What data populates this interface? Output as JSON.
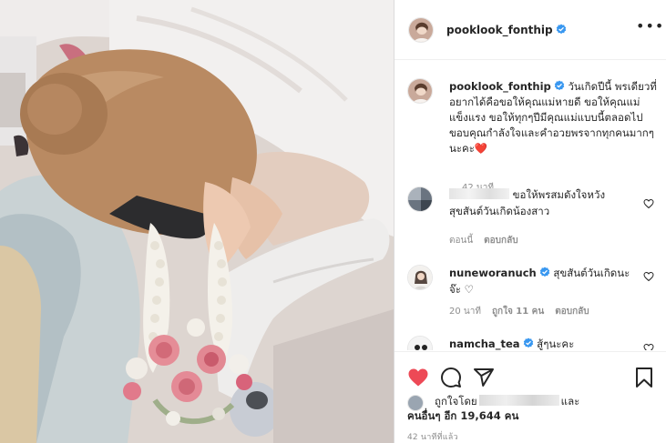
{
  "post": {
    "username": "pooklook_fonthip",
    "more_label": "•••",
    "image_alt": "Woman with garland bowing at hospital bed",
    "caption": {
      "username": "pooklook_fonthip",
      "text": "วันเกิดปีนี้ พรเดียวที่อยากได้คือขอให้คุณแม่หายดี ขอให้คุณแม่แข็งแรง ขอให้ทุกๆปีมีคุณแม่แบบนี้ตลอดไป ขอบคุณกำลังใจและคำอวยพรจากทุกคนมากๆนะคะ",
      "emoji": "❤️",
      "time": "42 นาที"
    },
    "comments": [
      {
        "username": "",
        "text": "ขอให้พรสมดังใจหวัง สุขสันต์วันเกิดน้องสาว",
        "meta": [
          "ตอนนี้",
          "ตอบกลับ"
        ],
        "verified": false
      },
      {
        "username": "nuneworanuch",
        "text": "สุขสันต์วันเกิดนะจ๊ะ ♡",
        "meta": [
          "20 นาที",
          "ถูกใจ 11 คน",
          "ตอบกลับ"
        ],
        "verified": true
      },
      {
        "username": "namcha_tea",
        "text": "สู้ๆนะคะ",
        "meta": [],
        "verified": true
      }
    ],
    "likes_prefix": "ถูกใจโดย",
    "likes_and": "และ",
    "likes_others": "คนอื่นๆ อีก 19,644 คน",
    "posted_ago": "42 นาทีที่แล้ว"
  },
  "icons": {
    "verified": "verified-badge-icon",
    "more": "more-options-icon",
    "like": "heart-icon",
    "comment": "comment-icon",
    "share": "share-icon",
    "save": "bookmark-icon"
  },
  "colors": {
    "liked": "#ed4956",
    "verified": "#3897f0",
    "muted": "#8e8e8e",
    "text": "#262626"
  }
}
